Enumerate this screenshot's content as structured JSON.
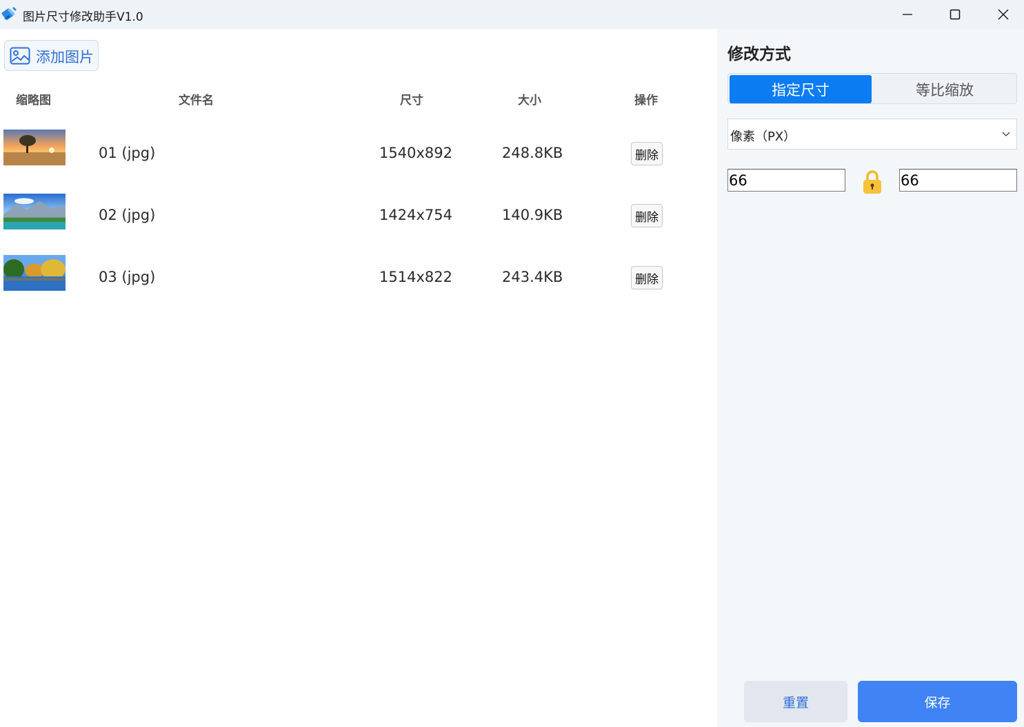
{
  "window": {
    "title": "图片尺寸修改助手V1.0",
    "controls": [
      "minimize",
      "maximize",
      "close"
    ]
  },
  "toolbar": {
    "add_images_label": "添加图片"
  },
  "table": {
    "headers": {
      "thumbnail": "缩略图",
      "filename": "文件名",
      "dimensions": "尺寸",
      "size": "大小",
      "actions": "操作"
    },
    "rows": [
      {
        "filename": "01 (jpg)",
        "dimensions": "1540x892",
        "size": "248.8KB",
        "action": "删除",
        "thumb": "sunset-field"
      },
      {
        "filename": "02 (jpg)",
        "dimensions": "1424x754",
        "size": "140.9KB",
        "action": "删除",
        "thumb": "mountain-lake"
      },
      {
        "filename": "03 (jpg)",
        "dimensions": "1514x822",
        "size": "243.4KB",
        "action": "删除",
        "thumb": "autumn-river"
      }
    ]
  },
  "settings": {
    "title": "修改方式",
    "modes": [
      {
        "label": "指定尺寸",
        "selected": true
      },
      {
        "label": "等比缩放",
        "selected": false
      }
    ],
    "unit": "像素（PX）",
    "width": "66",
    "height": "66",
    "aspect_locked": true,
    "reset_label": "重置",
    "save_label": "保存"
  },
  "colors": {
    "accent": "#0c7cf2",
    "save": "#3f83f5",
    "reset_bg": "#e2e6ee",
    "link_text": "#2f6fd6",
    "lock": "#f3b72e"
  }
}
